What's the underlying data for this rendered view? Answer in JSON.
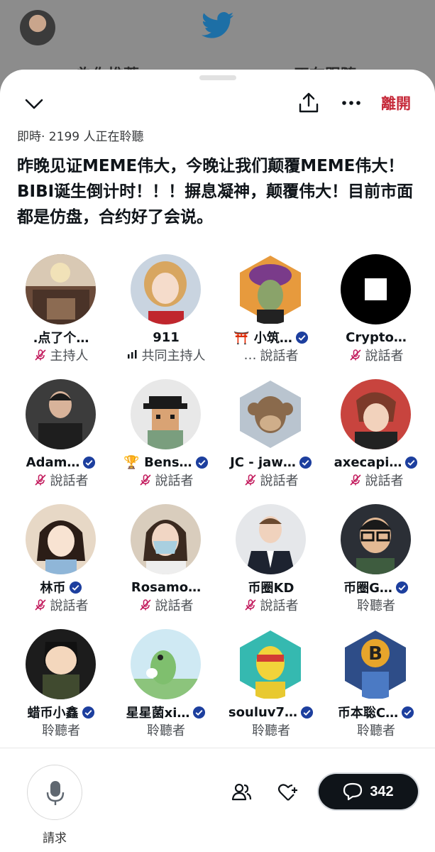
{
  "background": {
    "tab_left": "為你推薦",
    "tab_right": "正在跟隨"
  },
  "header": {
    "leave_label": "離開",
    "status": "即時· 2199 人正在聆聽",
    "title": "昨晚见证MEME伟大，今晚让我们颠覆MEME伟大！BIBI诞生倒计时！！！摒息凝神，颠覆伟大！目前市面都是仿盘，合约好了会说。"
  },
  "participants": [
    {
      "name": ".点了个…",
      "role": "主持人",
      "role_icon": "mic-off-icon",
      "verified": false
    },
    {
      "name": "911",
      "role": "共同主持人",
      "role_icon": "speaking-bars-icon",
      "verified": false
    },
    {
      "name": "⛩️ 小筑…",
      "role": "說話者",
      "role_icon": "ellipsis",
      "verified": true
    },
    {
      "name": "Crypto…",
      "role": "說話者",
      "role_icon": "mic-off-icon",
      "verified": false
    },
    {
      "name": "Adam…",
      "role": "說話者",
      "role_icon": "mic-off-icon",
      "verified": true
    },
    {
      "name": "🏆 Bens…",
      "role": "說話者",
      "role_icon": "mic-off-icon",
      "verified": true
    },
    {
      "name": "JC - jaw…",
      "role": "說話者",
      "role_icon": "mic-off-icon",
      "verified": true
    },
    {
      "name": "axecapi…",
      "role": "說話者",
      "role_icon": "mic-off-icon",
      "verified": true
    },
    {
      "name": "林币",
      "role": "說話者",
      "role_icon": "mic-off-icon",
      "verified": true
    },
    {
      "name": "Rosamo…",
      "role": "說話者",
      "role_icon": "mic-off-icon",
      "verified": false
    },
    {
      "name": "币圈KD",
      "role": "說話者",
      "role_icon": "mic-off-icon",
      "verified": false
    },
    {
      "name": "币圈G…",
      "role": "聆聽者",
      "role_icon": "",
      "verified": true
    },
    {
      "name": "蜡币小鑫",
      "role": "聆聽者",
      "role_icon": "",
      "verified": true
    },
    {
      "name": "星星菌xi…",
      "role": "聆聽者",
      "role_icon": "",
      "verified": true
    },
    {
      "name": "souluv7…",
      "role": "聆聽者",
      "role_icon": "",
      "verified": true
    },
    {
      "name": "币本聡C…",
      "role": "聆聽者",
      "role_icon": "",
      "verified": true
    }
  ],
  "footer": {
    "request_label": "請求",
    "comments_count": "342"
  },
  "colors": {
    "leave": "#c62a3a",
    "verified": "#1d3f9e",
    "mic_off": "#c2185b",
    "comments_bg": "#0f1419"
  }
}
